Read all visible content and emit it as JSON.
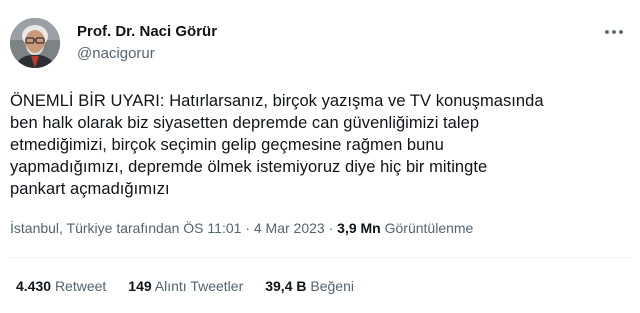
{
  "author": {
    "display_name": "Prof. Dr. Naci Görür",
    "handle": "@nacigorur"
  },
  "tweet": {
    "text": "ÖNEMLİ BİR UYARI: Hatırlarsanız, birçok yazışma ve TV konuşmasında\nben halk olarak biz siyasetten depremde can güvenliğimizi talep\netmediğimizi, birçok seçimin gelip geçmesine rağmen bunu\nyapmadığımızı, depremde ölmek istemiyoruz diye hiç bir mitingte\npankart açmadığımızı"
  },
  "meta": {
    "source": "İstanbul, Türkiye tarafından",
    "time": "ÖS 11:01",
    "separator": "·",
    "date": "4 Mar 2023",
    "views_count": "3,9 Mn",
    "views_label": "Görüntülenme"
  },
  "stats": {
    "retweets": {
      "count": "4.430",
      "label": "Retweet"
    },
    "quotes": {
      "count": "149",
      "label": "Alıntı Tweetler"
    },
    "likes": {
      "count": "39,4 B",
      "label": "Beğeni"
    }
  },
  "icons": {
    "more": "more-horizontal-icon",
    "avatar": "profile-photo"
  },
  "colors": {
    "text_primary": "#0f1419",
    "text_secondary": "#536471",
    "divider": "#eff3f4"
  }
}
